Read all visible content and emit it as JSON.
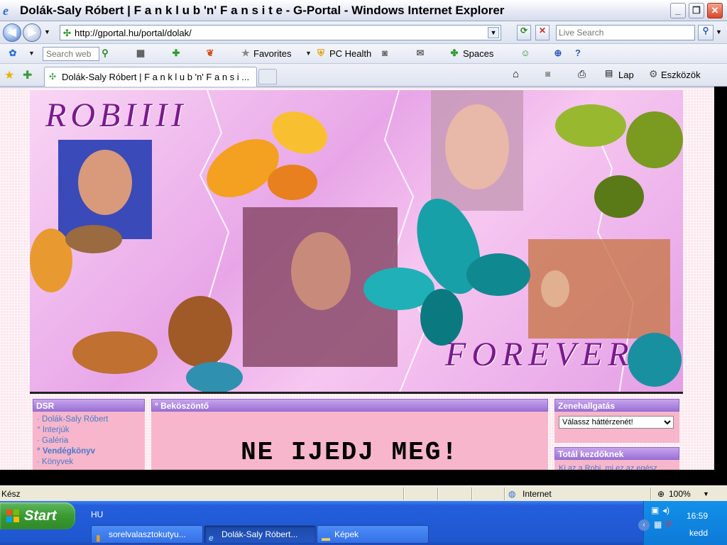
{
  "window": {
    "title": "Dolák-Saly Róbert | F a n k l u b 'n' F a n s i t e - G-Portal - Windows Internet Explorer",
    "min_label": "_",
    "max_label": "❐",
    "close_label": "✕"
  },
  "addressbar": {
    "url": "http://gportal.hu/portal/dolak/",
    "live_search_placeholder": "Live Search"
  },
  "toolbar": {
    "search_placeholder": "Search web",
    "favorites": "Favorites",
    "pc_health": "PC Health",
    "spaces": "Spaces"
  },
  "tabbar": {
    "active_tab": "Dolák-Saly Róbert | F a n k l u b 'n' F a n s i ...",
    "lap": "Lap",
    "eszkozok": "Eszközök"
  },
  "page": {
    "banner": {
      "title_top": "ROBIIII",
      "title_bottom": "FOREVER"
    },
    "left": {
      "header": "DSR",
      "items": [
        {
          "label": "Dolák-Saly Róbert",
          "bullet": "·",
          "bold": false
        },
        {
          "label": "Interjúk",
          "bullet": "°",
          "bold": false
        },
        {
          "label": "Galéria",
          "bullet": "·",
          "bold": false
        },
        {
          "label": "Vendégkönyv",
          "bullet": "°",
          "bold": true
        },
        {
          "label": "Könyvek",
          "bullet": "·",
          "bold": false
        }
      ]
    },
    "middle": {
      "header": "° Beköszöntő",
      "big_text": "NE IJEDJ MEG!"
    },
    "right": {
      "music_header": "Zenehallgatás",
      "select_value": "Válassz háttérzenét!",
      "beginners_header": "Totál kezdőknek",
      "beginners_link": "Ki az a Robi, mi ez az egész"
    }
  },
  "statusbar": {
    "status": "Kész",
    "zone": "Internet",
    "zoom": "100%"
  },
  "taskbar": {
    "start": "Start",
    "lang": "HU",
    "items": [
      {
        "label": "sorelvalasztokutyu..."
      },
      {
        "label": "Dolák-Saly Róbert..."
      },
      {
        "label": "Képek"
      }
    ],
    "time": "16:59",
    "day": "kedd"
  },
  "colors": {
    "accent": "#245edb",
    "page_pink": "#f7b6cb",
    "link_blue": "#4a79c8",
    "banner_purple": "#7a1a8c"
  }
}
